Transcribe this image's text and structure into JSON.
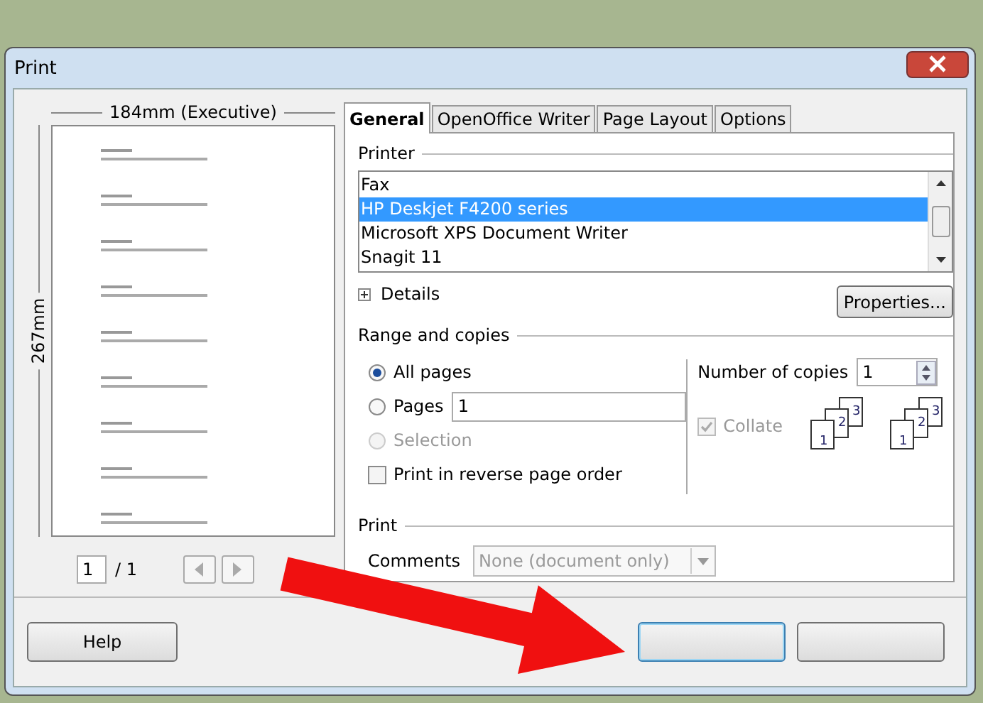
{
  "window": {
    "title": "Print"
  },
  "preview": {
    "width_label": "184mm (Executive)",
    "height_label": "267mm",
    "page_field": "1",
    "page_count": "/ 1"
  },
  "tabs": [
    {
      "label": "General",
      "selected": true
    },
    {
      "label": "OpenOffice Writer",
      "selected": false
    },
    {
      "label": "Page Layout",
      "selected": false
    },
    {
      "label": "Options",
      "selected": false
    }
  ],
  "printer": {
    "label": "Printer",
    "items": [
      {
        "name": "Fax",
        "selected": false
      },
      {
        "name": "HP Deskjet F4200 series",
        "selected": true
      },
      {
        "name": "Microsoft XPS Document Writer",
        "selected": false
      },
      {
        "name": "Snagit 11",
        "selected": false
      }
    ],
    "details": {
      "label": "Details",
      "expanded": false
    },
    "properties_button": "Properties..."
  },
  "range": {
    "label": "Range and copies",
    "options": [
      {
        "label": "All pages",
        "selected": true,
        "disabled": false
      },
      {
        "label": "Pages",
        "selected": false,
        "disabled": false,
        "value": "1"
      },
      {
        "label": "Selection",
        "selected": false,
        "disabled": true
      }
    ],
    "reverse": {
      "label": "Print in reverse page order",
      "checked": false
    },
    "copies_label": "Number of copies",
    "copies": "1",
    "collate": {
      "label": "Collate",
      "checked": true,
      "disabled": true
    },
    "collate_icons": [
      {
        "pages": [
          "1",
          "2",
          "3"
        ]
      },
      {
        "pages": [
          "1",
          "2",
          "3"
        ]
      }
    ]
  },
  "print": {
    "label": "Print",
    "comments_label": "Comments",
    "comments": "None (document only)",
    "comments_disabled": true
  },
  "help_button": "Help",
  "dialog_buttons": [
    {
      "default": true
    },
    {
      "default": false
    }
  ]
}
